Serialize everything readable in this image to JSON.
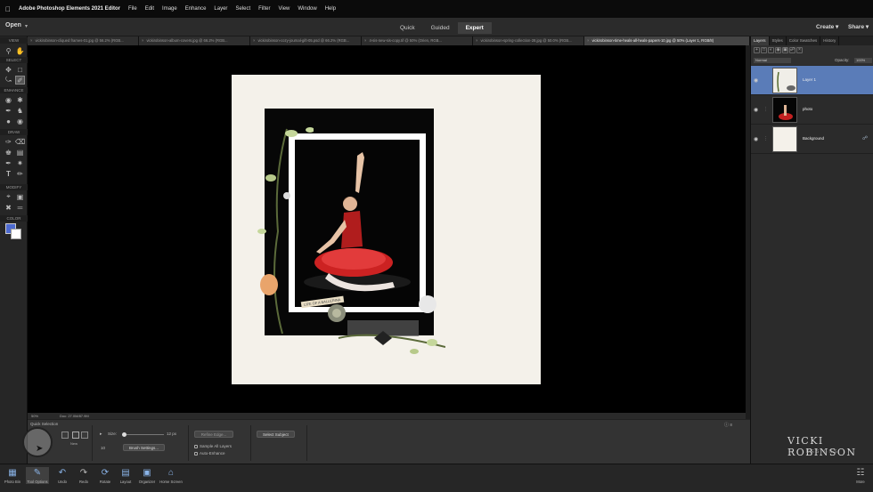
{
  "menubar": {
    "app_name": "Adobe Photoshop Elements 2021 Editor",
    "items": [
      "File",
      "Edit",
      "Image",
      "Enhance",
      "Layer",
      "Select",
      "Filter",
      "View",
      "Window",
      "Help"
    ]
  },
  "topbar": {
    "open_label": "Open",
    "modes": [
      "Quick",
      "Guided",
      "Expert"
    ],
    "active_mode": "Expert",
    "create_label": "Create",
    "share_label": "Share"
  },
  "toolbox": {
    "sections": [
      "VIEW",
      "SELECT",
      "ENHANCE",
      "DRAW",
      "MODIFY",
      "COLOR"
    ],
    "colors": {
      "foreground": "#4d6ad0",
      "background": "#ffffff"
    }
  },
  "tabs": [
    {
      "label": "vickirobinson-cliqued frames-01.jpg @ 56.2% (RGB...",
      "active": false
    },
    {
      "label": "vickirobinson-album-covers.jpg @ 66.2% (RGB...",
      "active": false
    },
    {
      "label": "vickirobinson-cozy-journal-gift-05.psd @ 66.2% (RGB...",
      "active": false
    },
    {
      "label": "4-sis-new-sis-copy.tif @ 50% (Orien, RGB...",
      "active": false
    },
    {
      "label": "vickirobinson-spring-collection-28.jpg @ 50.0% (RGB...",
      "active": false
    },
    {
      "label": "vickirobinson-time-heals-all-heals-papers-10.jpg @ 50% (Layer 1, RGB/8)",
      "active": true
    }
  ],
  "statusbar": {
    "zoom": "50%",
    "doc_size": "Doc: 27.0M/87.9M"
  },
  "canvas": {
    "tag_text": "LIFE OF A BALLERINA"
  },
  "tool_options": {
    "title": "Quick Selection",
    "new_label": "New",
    "size_label": "Size:",
    "size_value": "12 px",
    "brush_size_num": "10",
    "brush_settings_label": "Brush Settings...",
    "refine_edge_label": "Refine Edge...",
    "sample_all_layers": "Sample All Layers",
    "auto_enhance": "Auto-Enhance",
    "select_subject_label": "Select Subject"
  },
  "panels": {
    "tabs": [
      "Layers",
      "Styles",
      "Color Swatches",
      "History"
    ],
    "active_tab": "Layers",
    "blend_mode": "Normal",
    "opacity_label": "Opacity:",
    "opacity_value": "100%",
    "layers": [
      {
        "name": "Layer 1",
        "selected": true
      },
      {
        "name": "photo",
        "selected": false
      },
      {
        "name": "Background",
        "selected": false
      }
    ]
  },
  "watermark": {
    "name": "VICKI ROBINSON",
    "sub": "DESIGNS"
  },
  "taskbar": {
    "items": [
      {
        "label": "Photo Bin",
        "icon": "photo-bin-icon"
      },
      {
        "label": "Tool Options",
        "icon": "tool-options-icon"
      },
      {
        "label": "Undo",
        "icon": "undo-icon"
      },
      {
        "label": "Redo",
        "icon": "redo-icon"
      },
      {
        "label": "Rotate",
        "icon": "rotate-icon"
      },
      {
        "label": "Layout",
        "icon": "layout-icon"
      },
      {
        "label": "Organizer",
        "icon": "organizer-icon"
      },
      {
        "label": "Home Screen",
        "icon": "home-icon"
      },
      {
        "label": "More",
        "icon": "more-icon"
      }
    ]
  }
}
